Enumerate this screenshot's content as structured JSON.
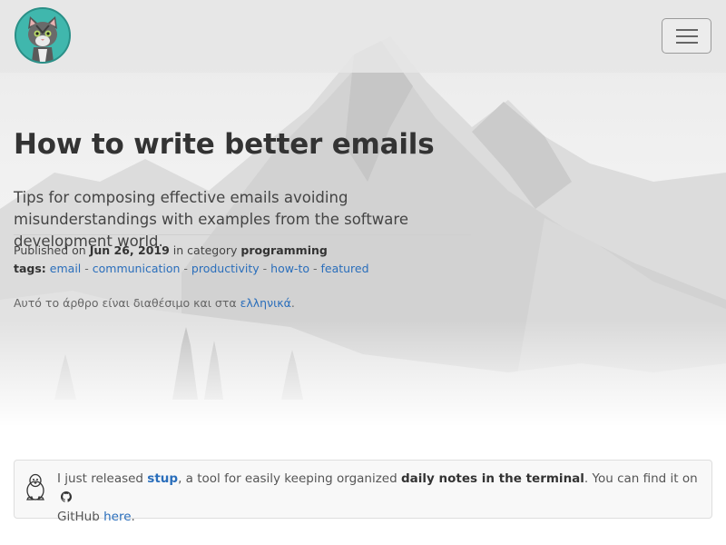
{
  "nav": {
    "avatar_alt": "cat avatar",
    "menu_icon": "hamburger-menu-icon"
  },
  "article": {
    "title": "How to write better emails",
    "subtitle": "Tips for composing effective emails avoiding misunderstandings with examples from the software development world.",
    "published_prefix": "Published on",
    "published_date": "Jun 26, 2019",
    "category_prefix": "in category",
    "category": "programming",
    "tags_label": "tags:",
    "tags": [
      "email",
      "communication",
      "productivity",
      "how-to",
      "featured"
    ],
    "tag_separator": "-",
    "translation_text": "Αυτό το άρθρο είναι διαθέσιμο και στα",
    "translation_link": "ελληνικά",
    "translation_end": "."
  },
  "notice": {
    "icon": "tux-icon",
    "t1": "I just released",
    "link1": "stup",
    "t2": ", a tool for easily keeping organized",
    "bold1": "daily notes in the terminal",
    "t3": ". You can find it on",
    "github_icon": "github-icon",
    "t4": "GitHub",
    "link2": "here",
    "t5": "."
  },
  "colors": {
    "link": "#2a6ebb",
    "avatar_bg": "#40b7ad",
    "notice_bg": "#f8f8f8"
  }
}
